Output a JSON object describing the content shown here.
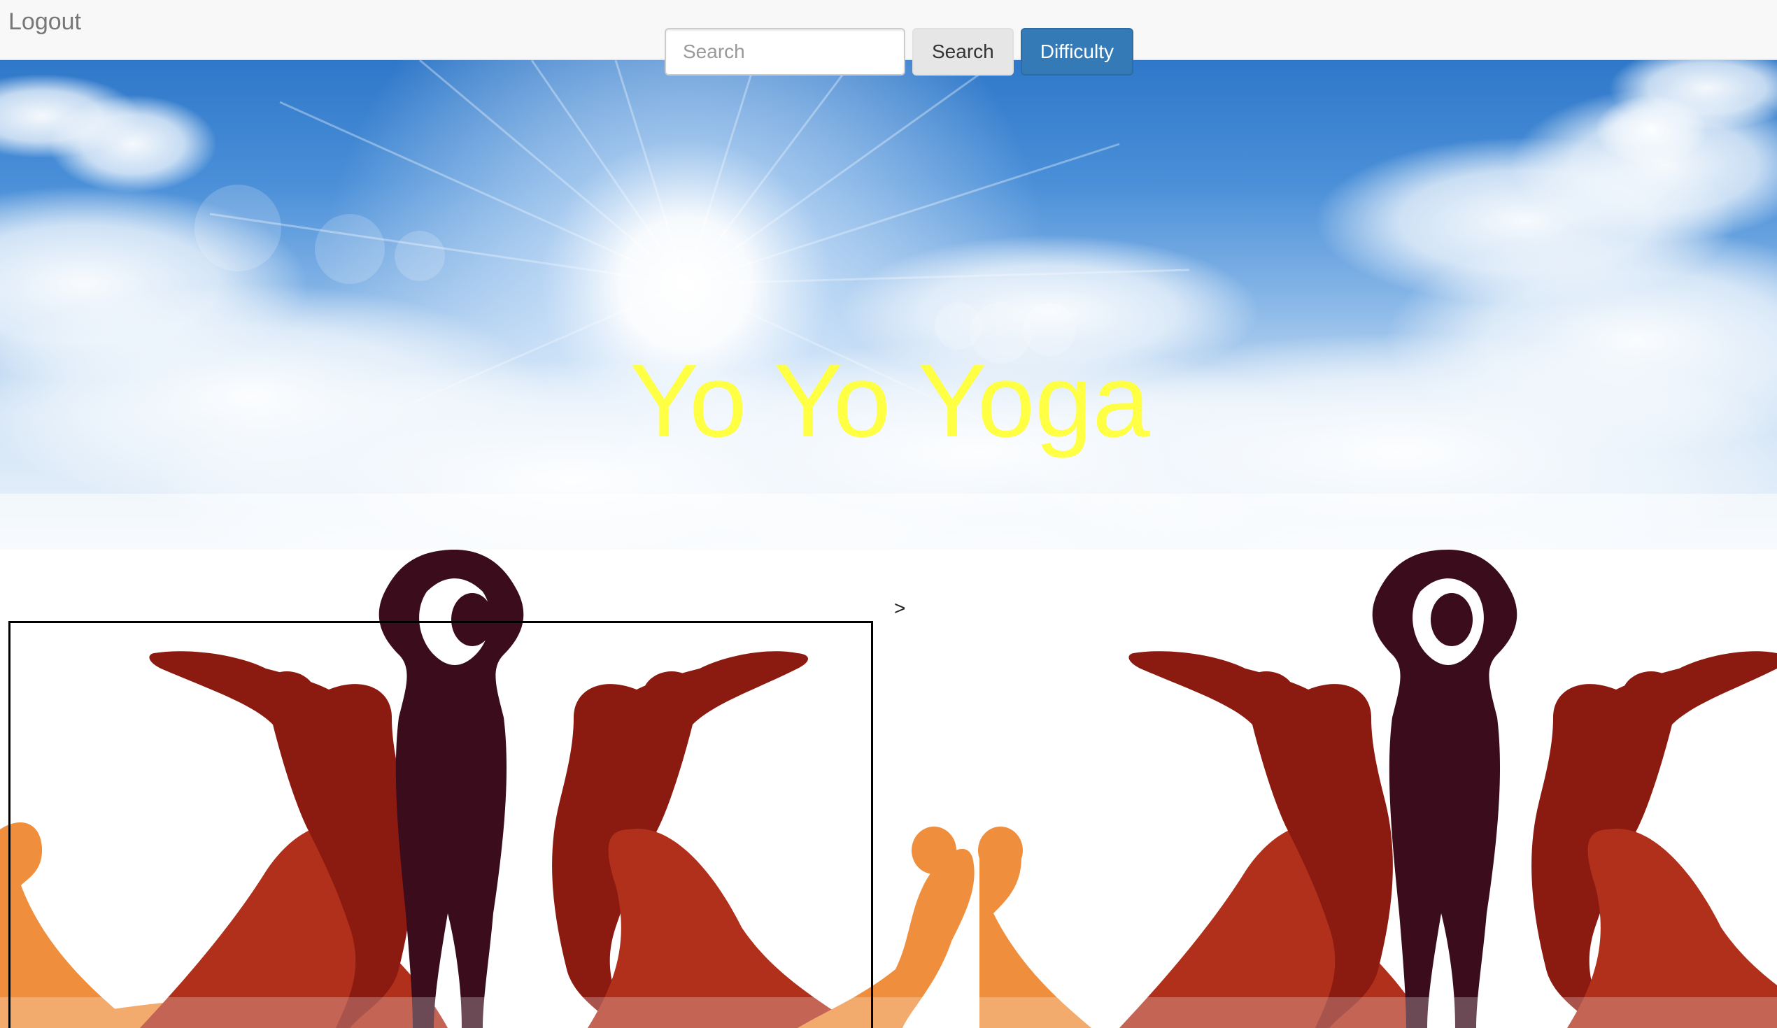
{
  "navbar": {
    "logout_label": "Logout",
    "search_placeholder": "Search",
    "search_value": "",
    "search_button_label": "Search",
    "difficulty_button_label": "Difficulty"
  },
  "hero": {
    "title": "Yo Yo Yoga",
    "title_color": "#ffff44"
  },
  "gallery": {
    "next_marker": ">",
    "images": [
      {
        "name": "yoga-poses-silhouettes"
      },
      {
        "name": "yoga-poses-silhouettes"
      }
    ]
  },
  "colors": {
    "primary": "#337ab7",
    "dark_figure": "#3a0c1c",
    "red_figure": "#8b1a10",
    "mid_figure": "#b0301c",
    "orange_figure": "#ef8e3c"
  }
}
